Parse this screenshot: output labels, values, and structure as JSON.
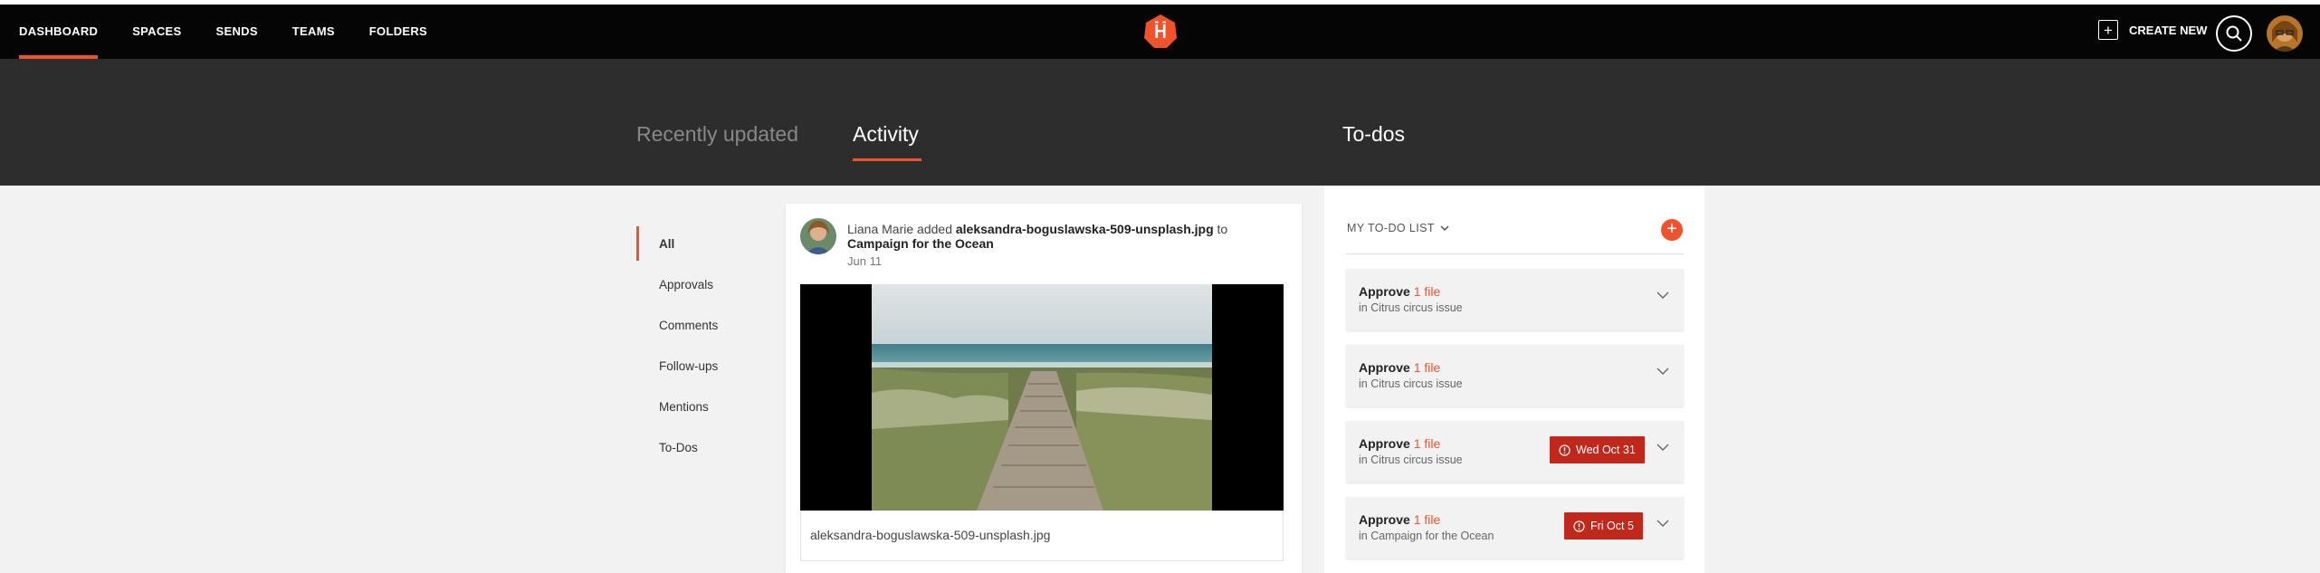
{
  "nav": {
    "items": [
      "DASHBOARD",
      "SPACES",
      "SENDS",
      "TEAMS",
      "FOLDERS"
    ],
    "create_new": "CREATE NEW"
  },
  "tabs": {
    "recent": "Recently updated",
    "activity": "Activity",
    "todos": "To-dos"
  },
  "filters": [
    "All",
    "Approvals",
    "Comments",
    "Follow-ups",
    "Mentions",
    "To-Dos"
  ],
  "activity": {
    "actor": "Liana Marie",
    "verb": "added",
    "file": "aleksandra-boguslawska-509-unsplash.jpg",
    "preposition": "to",
    "target": "Campaign for the Ocean",
    "date": "Jun 11",
    "caption": "aleksandra-boguslawska-509-unsplash.jpg"
  },
  "todo": {
    "header": "MY TO-DO LIST",
    "items": [
      {
        "verb": "Approve",
        "count": "1 file",
        "where": "in Citrus circus issue",
        "due": ""
      },
      {
        "verb": "Approve",
        "count": "1 file",
        "where": "in Citrus circus issue",
        "due": ""
      },
      {
        "verb": "Approve",
        "count": "1 file",
        "where": "in Citrus circus issue",
        "due": "Wed Oct 31"
      },
      {
        "verb": "Approve",
        "count": "1 file",
        "where": "in Campaign for the Ocean",
        "due": "Fri Oct 5"
      }
    ]
  },
  "colors": {
    "accent": "#f0532b",
    "due_badge": "#c0281c",
    "topbar": "#050505",
    "band": "#2d2d2d"
  }
}
